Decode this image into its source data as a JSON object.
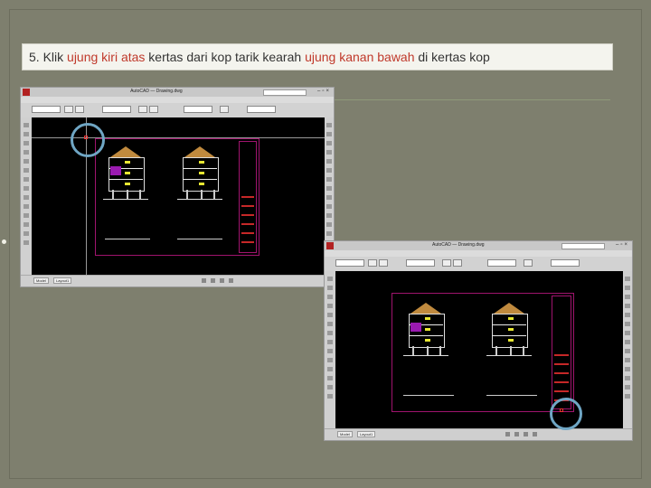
{
  "instruction": {
    "number": "5.",
    "segments": [
      {
        "text": "Klik ",
        "highlight": false
      },
      {
        "text": "ujung kiri atas",
        "highlight": true
      },
      {
        "text": " kertas dari kop tarik kearah ",
        "highlight": false
      },
      {
        "text": "ujung kanan bawah",
        "highlight": true
      },
      {
        "text": " di kertas kop",
        "highlight": false
      }
    ]
  },
  "colors": {
    "background": "#7e7f6e",
    "highlight": "#c0392b",
    "callout_ring": "#6fa6c4",
    "sheet_border": "#a0146e"
  },
  "screenshots": [
    {
      "id": "first-corner",
      "callout_position": "top-left"
    },
    {
      "id": "opposite-corner",
      "callout_position": "bottom-right"
    }
  ]
}
